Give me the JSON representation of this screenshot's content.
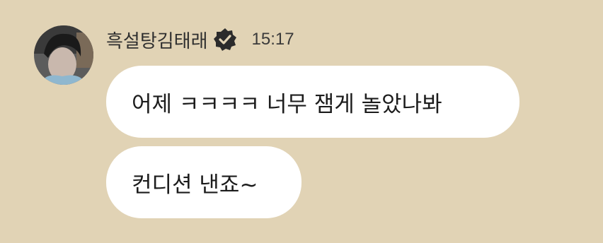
{
  "chat": {
    "sender": {
      "name": "흑설탕김태래",
      "verified": true,
      "avatar_icon": "profile-photo"
    },
    "timestamp": "15:17",
    "messages": [
      {
        "text": "어제 ㅋㅋㅋㅋ 너무 잼게 놀았나봐"
      },
      {
        "text": "컨디션 낸죠~"
      }
    ]
  },
  "colors": {
    "background": "#e1d3b5",
    "bubble": "#ffffff",
    "text": "#1c1c1c",
    "badge": "#2b2b2b"
  }
}
